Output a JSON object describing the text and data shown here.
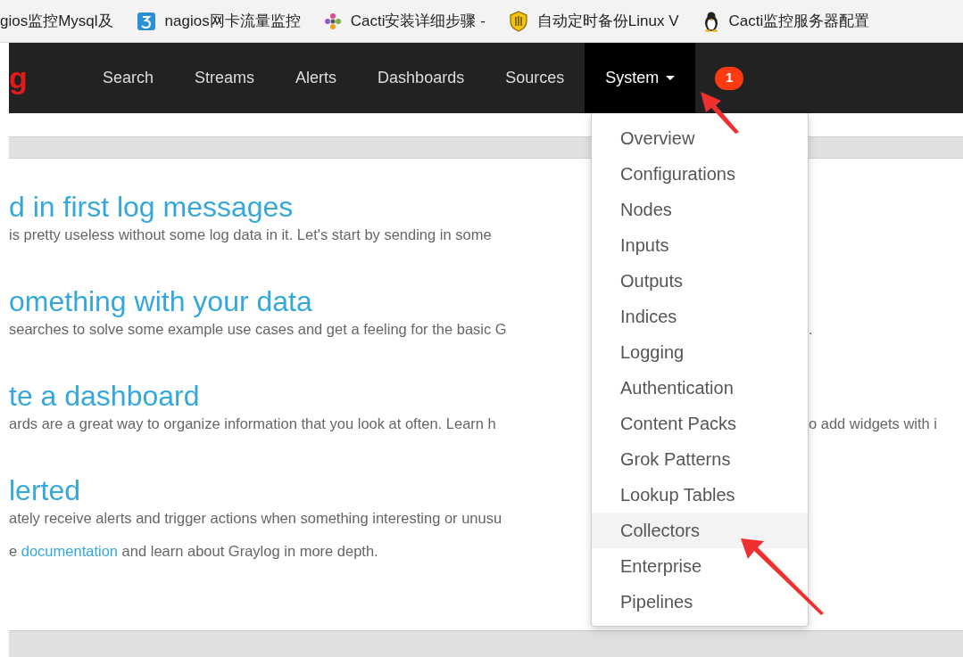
{
  "bookmarks": [
    {
      "label": "gios监控Mysql及",
      "kind": "none"
    },
    {
      "label": "nagios网卡流量监控",
      "kind": "number"
    },
    {
      "label": "Cacti安装详细步骤 -",
      "kind": "flower"
    },
    {
      "label": "自动定时备份Linux V",
      "kind": "shield"
    },
    {
      "label": "Cacti监控服务器配置",
      "kind": "penguin"
    }
  ],
  "navbar": {
    "logo": "g",
    "items": [
      {
        "label": "Search",
        "selected": false,
        "dropdown": false
      },
      {
        "label": "Streams",
        "selected": false,
        "dropdown": false
      },
      {
        "label": "Alerts",
        "selected": false,
        "dropdown": false
      },
      {
        "label": "Dashboards",
        "selected": false,
        "dropdown": false
      },
      {
        "label": "Sources",
        "selected": false,
        "dropdown": false
      },
      {
        "label": "System",
        "selected": true,
        "dropdown": true
      }
    ],
    "badge": "1"
  },
  "dropdown": {
    "items": [
      {
        "label": "Overview",
        "hovered": false
      },
      {
        "label": "Configurations",
        "hovered": false
      },
      {
        "label": "Nodes",
        "hovered": false
      },
      {
        "label": "Inputs",
        "hovered": false
      },
      {
        "label": "Outputs",
        "hovered": false
      },
      {
        "label": "Indices",
        "hovered": false
      },
      {
        "label": "Logging",
        "hovered": false
      },
      {
        "label": "Authentication",
        "hovered": false
      },
      {
        "label": "Content Packs",
        "hovered": false
      },
      {
        "label": "Grok Patterns",
        "hovered": false
      },
      {
        "label": "Lookup Tables",
        "hovered": false
      },
      {
        "label": "Collectors",
        "hovered": true
      },
      {
        "label": "Enterprise",
        "hovered": false
      },
      {
        "label": "Pipelines",
        "hovered": false
      }
    ]
  },
  "sections": [
    {
      "heading": "d in first log messages",
      "text": "is pretty useless without some log data in it. Let's start by sending in some"
    },
    {
      "heading": "omething with your data",
      "text": "searches to solve some example use cases and get a feeling for the basic G",
      "tail": "."
    },
    {
      "heading": "te a dashboard",
      "text": "ards are a great way to organize information that you look at often. Learn h",
      "tail": "o add widgets with i"
    },
    {
      "heading": "lerted",
      "text": "ately receive alerts and trigger actions when something interesting or unusu"
    }
  ],
  "footer_line": {
    "before": "e",
    "link": "documentation",
    "after": "and learn about Graylog in more depth."
  }
}
